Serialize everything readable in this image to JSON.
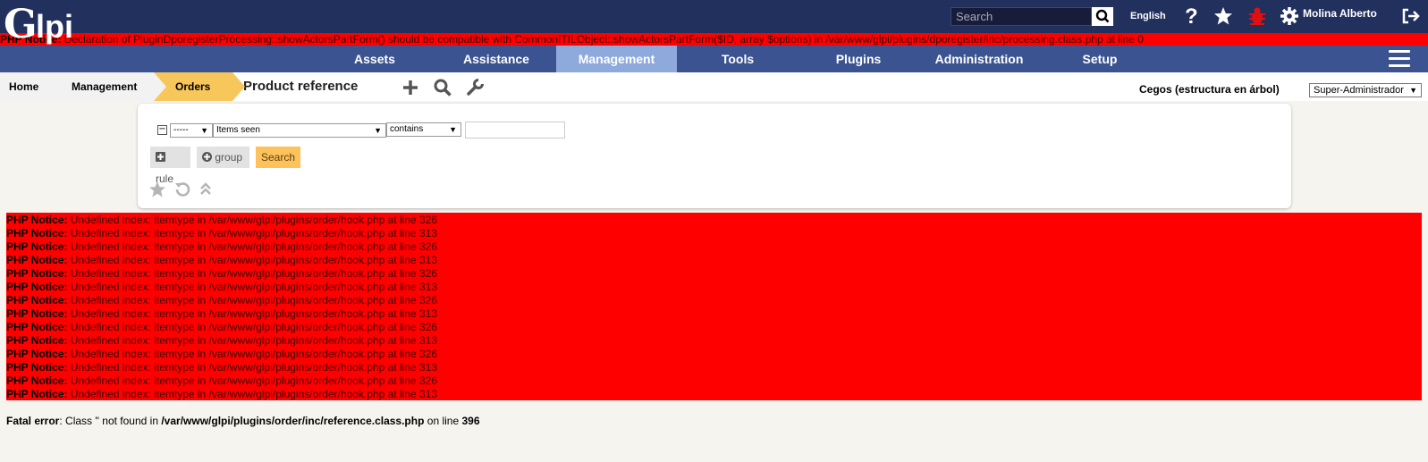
{
  "header": {
    "logo_text": "Glpi",
    "search_placeholder": "Search",
    "language": "English",
    "user_name": "Molina Alberto",
    "icons": [
      "search-icon",
      "help-icon",
      "star-icon",
      "bug-icon",
      "gear-icon",
      "logout-icon"
    ]
  },
  "notice_top": {
    "label": "PHP Notice:",
    "text": " Declaration of PluginDporegisterProcessing::showActorsPartForm() should be compatible with CommonITILObject::showActorsPartForm($ID, array $options) in /var/www/glpi/plugins/dporegister/inc/processing.class.php at line 0"
  },
  "menu": {
    "items": [
      "Assets",
      "Assistance",
      "Management",
      "Tools",
      "Plugins",
      "Administration",
      "Setup"
    ],
    "active": "Management"
  },
  "breadcrumb": {
    "home": "Home",
    "management": "Management",
    "orders": "Orders",
    "title": "Product reference"
  },
  "entity": {
    "label": "Cegos (estructura en árbol)",
    "profile": "Super-Administrador"
  },
  "search": {
    "link_value": "-----",
    "field_value": "Items seen",
    "operator_value": "contains",
    "criteria_value": "",
    "rule_label": "rule",
    "group_label": "group",
    "search_label": "Search"
  },
  "notices": {
    "label": "PHP Notice:",
    "lines": [
      " Undefined index: itemtype in /var/www/glpi/plugins/order/hook.php at line 326",
      " Undefined index: itemtype in /var/www/glpi/plugins/order/hook.php at line 313",
      " Undefined index: itemtype in /var/www/glpi/plugins/order/hook.php at line 326",
      " Undefined index: itemtype in /var/www/glpi/plugins/order/hook.php at line 313",
      " Undefined index: itemtype in /var/www/glpi/plugins/order/hook.php at line 326",
      " Undefined index: itemtype in /var/www/glpi/plugins/order/hook.php at line 313",
      " Undefined index: itemtype in /var/www/glpi/plugins/order/hook.php at line 326",
      " Undefined index: itemtype in /var/www/glpi/plugins/order/hook.php at line 313",
      " Undefined index: itemtype in /var/www/glpi/plugins/order/hook.php at line 326",
      " Undefined index: itemtype in /var/www/glpi/plugins/order/hook.php at line 313",
      " Undefined index: itemtype in /var/www/glpi/plugins/order/hook.php at line 326",
      " Undefined index: itemtype in /var/www/glpi/plugins/order/hook.php at line 313",
      " Undefined index: itemtype in /var/www/glpi/plugins/order/hook.php at line 326",
      " Undefined index: itemtype in /var/www/glpi/plugins/order/hook.php at line 313"
    ]
  },
  "fatal": {
    "label": "Fatal error",
    "text1": ": Class '' not found in ",
    "path": "/var/www/glpi/plugins/order/inc/reference.class.php",
    "text2": " on line ",
    "line": "396"
  },
  "colors": {
    "header_bg": "#22305e",
    "menu_bg": "#3b5491",
    "menu_active_bg": "#8ea9db",
    "notice_bg": "#ff0000",
    "orders_crumb_bg": "#f7c75b",
    "search_button_bg": "#fdc25b",
    "bug_icon": "#e01010"
  }
}
